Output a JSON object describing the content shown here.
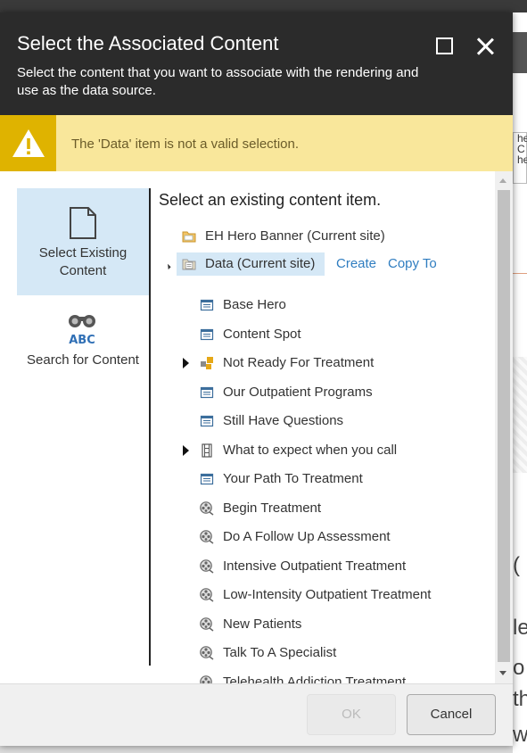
{
  "dialog": {
    "title": "Select the Associated Content",
    "subtitle": "Select the content that you want to associate with the rendering and use as the data source.",
    "maximize_icon": "maximize-icon",
    "close_icon": "close-icon"
  },
  "warning": {
    "text": "The 'Data' item is not a valid selection.",
    "icon": "warning-icon",
    "color": "#f9e79b",
    "accent": "#dfb300"
  },
  "nav": {
    "items": [
      {
        "label": "Select Existing Content",
        "icon": "document-icon",
        "active": true
      },
      {
        "label": "Search for Content",
        "icon": "binoculars-icon",
        "active": false
      }
    ]
  },
  "content": {
    "heading": "Select an existing content item.",
    "root": {
      "label": "EH Hero Banner (Current site)",
      "icon": "folder-icon"
    },
    "data_node": {
      "label": "Data (Current site)",
      "icon": "data-folder-icon",
      "expanded": true
    },
    "actions": {
      "create": "Create",
      "copy_to": "Copy To"
    },
    "children": [
      {
        "label": "Base Hero",
        "icon": "template-icon",
        "expandable": false
      },
      {
        "label": "Content Spot",
        "icon": "template-icon",
        "expandable": false
      },
      {
        "label": "Not Ready For Treatment",
        "icon": "blocks-icon",
        "expandable": true
      },
      {
        "label": "Our Outpatient Programs",
        "icon": "template-icon",
        "expandable": false
      },
      {
        "label": "Still Have Questions",
        "icon": "template-icon",
        "expandable": false
      },
      {
        "label": "What to expect when you call",
        "icon": "film-icon",
        "expandable": true
      },
      {
        "label": "Your Path To Treatment",
        "icon": "template-icon",
        "expandable": false
      },
      {
        "label": "Begin Treatment",
        "icon": "reel-icon",
        "expandable": false
      },
      {
        "label": "Do A Follow Up Assessment",
        "icon": "reel-icon",
        "expandable": false
      },
      {
        "label": "Intensive Outpatient Treatment",
        "icon": "reel-icon",
        "expandable": false
      },
      {
        "label": "Low-Intensity Outpatient Treatment",
        "icon": "reel-icon",
        "expandable": false
      },
      {
        "label": "New Patients",
        "icon": "reel-icon",
        "expandable": false
      },
      {
        "label": "Talk To A Specialist",
        "icon": "reel-icon",
        "expandable": false
      },
      {
        "label": "Telehealth Addiction Treatment",
        "icon": "reel-icon",
        "expandable": false
      }
    ]
  },
  "footer": {
    "ok_label": "OK",
    "cancel_label": "Cancel"
  },
  "background": {
    "panel_lines": [
      "he",
      "C",
      "he"
    ],
    "chars": [
      "(",
      "le",
      "o",
      "th",
      "w"
    ]
  }
}
